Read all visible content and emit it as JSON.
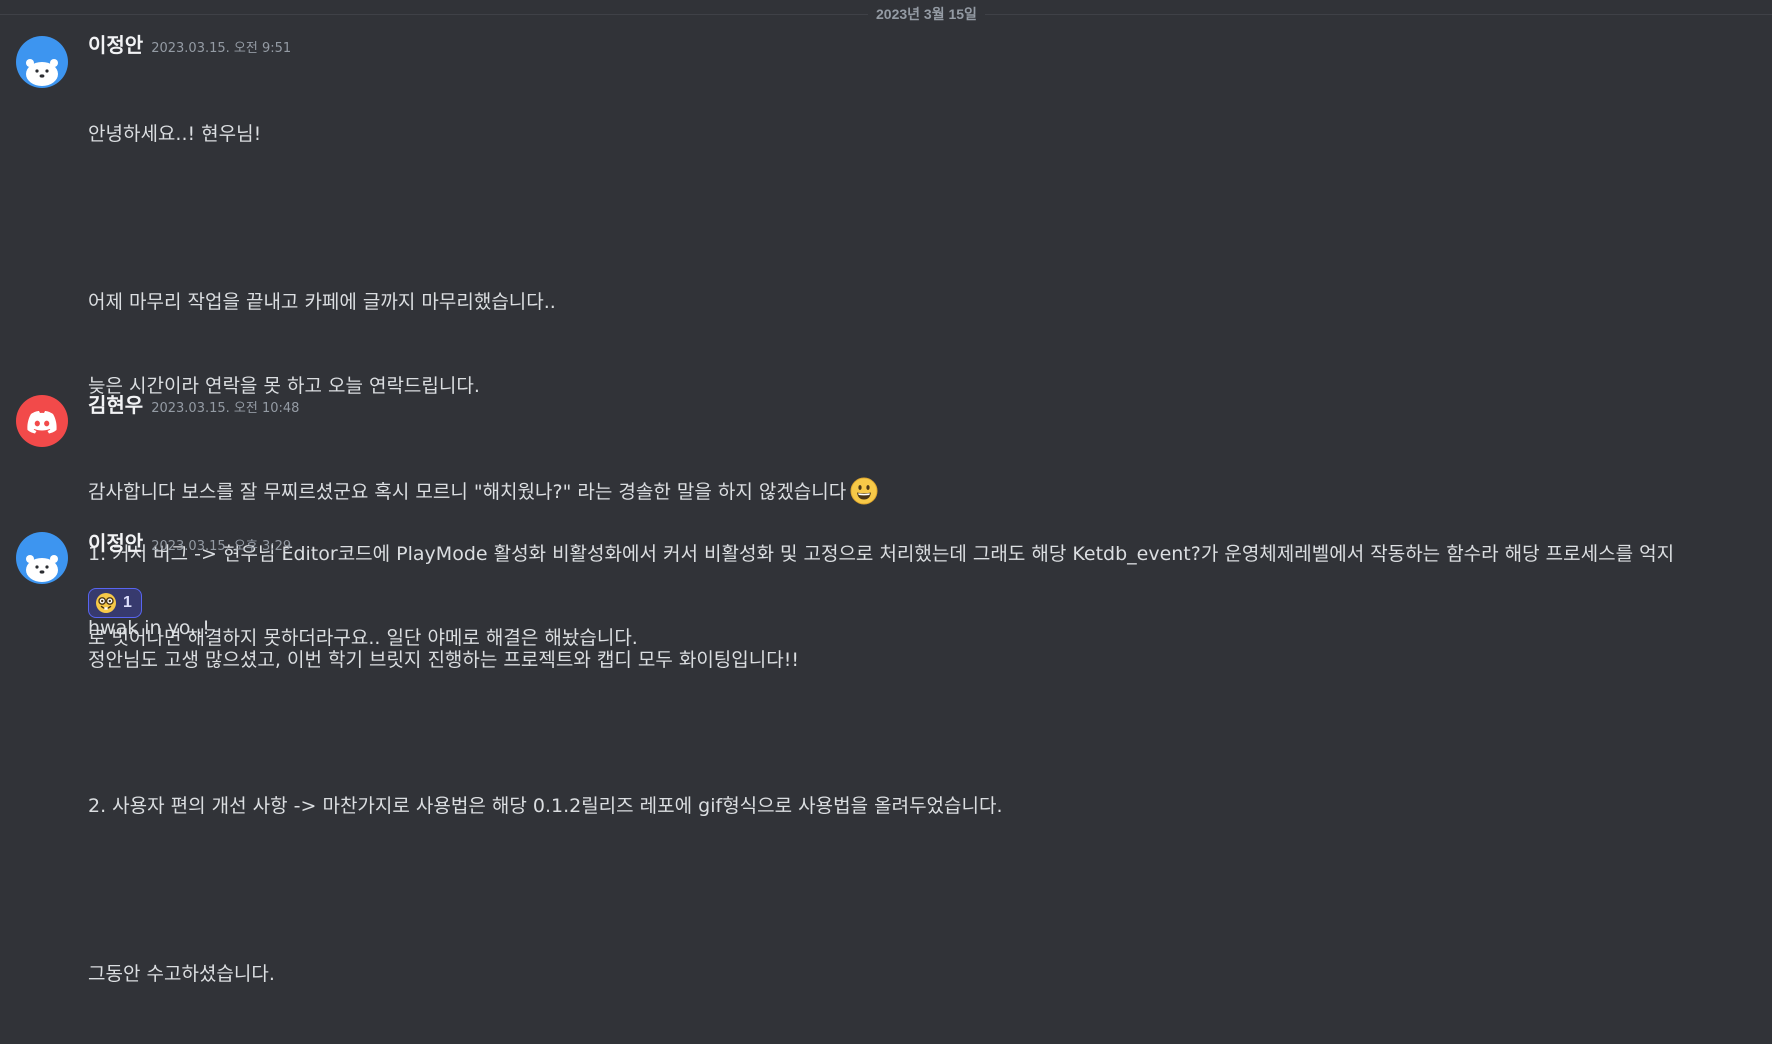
{
  "date_divider": "2023년 3월 15일",
  "messages": [
    {
      "username": "이정안",
      "timestamp": "2023.03.15. 오전 9:51",
      "avatar": "bear-avatar-icon",
      "lines": [
        "안녕하세요..! 현우님!",
        "",
        "어제 마무리 작업을 끝내고 카페에 글까지 마무리했습니다..",
        "늦은 시간이라 연락을 못 하고 오늘 연락드립니다.",
        "",
        "1. 커서 버그 -> 현우님 Editor코드에 PlayMode 활성화 비활성화에서 커서 비활성화 및 고정으로 처리했는데 그래도 해당 Ketdb_event?가 운영체제레벨에서 작동하는 함수라 해당 프로세스를 억지",
        "로 벗어나면 해결하지 못하더라구요.. 일단 야메로 해결은 해놨습니다.",
        "",
        "2. 사용자 편의 개선 사항 -> 마찬가지로 사용법은 해당 0.1.2릴리즈 레포에 gif형식으로 사용법을 올려두었습니다.",
        "",
        "그동안 수고하셨습니다."
      ]
    },
    {
      "username": "김현우",
      "timestamp": "2023.03.15. 오전 10:48",
      "avatar": "discord-logo-icon",
      "lines": [
        "감사합니다 보스를 잘 무찌르셨군요 혹시 모르니 \"해치웠나?\" 라는 경솔한 말을 하지 않겠습니다",
        "",
        "정안님도 고생 많으셨고, 이번 학기 브릿지 진행하는 프로젝트와 캡디 모두 화이팅입니다!!"
      ],
      "emoji": "grinning-face-emoji"
    },
    {
      "username": "이정안",
      "timestamp": "2023.03.15. 오후 3:29",
      "avatar": "bear-avatar-icon",
      "lines": [
        "hwak in yo..!"
      ],
      "reaction": {
        "emoji": "nerd-face-emoji",
        "count": "1"
      }
    }
  ],
  "colors": {
    "background": "#313338",
    "text": "#dbdee1",
    "username": "#f2f3f5",
    "timestamp": "#949ba4",
    "avatar_blue": "#3d95f0",
    "avatar_red": "#f24a4a",
    "reaction_bg": "#373a6e",
    "reaction_border": "#5865f2"
  }
}
